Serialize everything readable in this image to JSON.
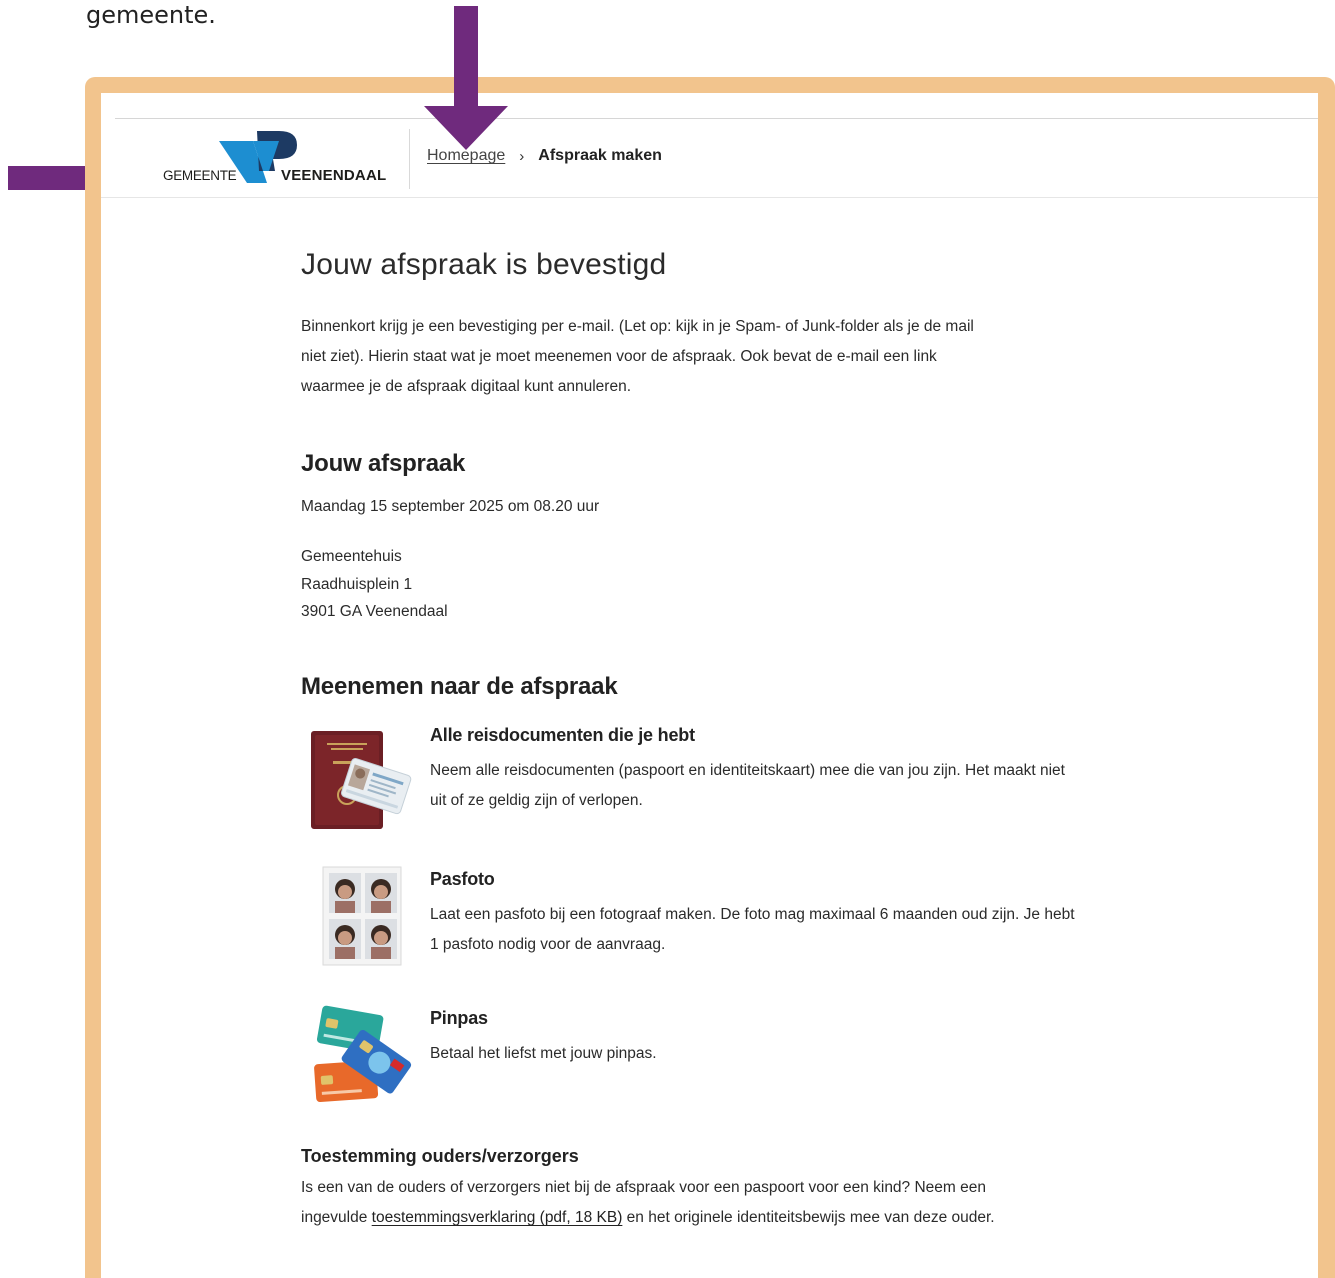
{
  "intro": {
    "text": "gemeente."
  },
  "header": {
    "logo_gemeente": "GEMEENTE",
    "logo_veenendaal": "VEENENDAAL",
    "breadcrumb": {
      "home": "Homepage",
      "separator": "›",
      "current": "Afspraak maken"
    }
  },
  "main": {
    "title": "Jouw afspraak is bevestigd",
    "confirmation": "Binnenkort krijg je een bevestiging per e-mail. (Let op: kijk in je Spam- of Junk-folder als je de mail niet ziet). Hierin staat wat je moet meenemen voor de afspraak. Ook bevat de e-mail een link waarmee je de afspraak digitaal kunt annuleren.",
    "appointment": {
      "heading": "Jouw afspraak",
      "date": "Maandag 15 september 2025 om 08.20 uur",
      "location": "Gemeentehuis",
      "street": "Raadhuisplein 1",
      "city": "3901 GA Veenendaal"
    },
    "bring": {
      "heading": "Meenemen naar de afspraak",
      "items": [
        {
          "title": "Alle reisdocumenten die je hebt",
          "desc": "Neem alle reisdocumenten (paspoort en identiteitskaart) mee die van jou zijn. Het maakt niet uit of ze geldig zijn of verlopen.",
          "icon": "passport-id-image"
        },
        {
          "title": "Pasfoto",
          "desc": "Laat een pasfoto bij een fotograaf maken. De foto mag maximaal 6 maanden oud zijn. Je hebt 1 pasfoto nodig voor de aanvraag.",
          "icon": "passport-photos-image"
        },
        {
          "title": "Pinpas",
          "desc": "Betaal het liefst met jouw pinpas.",
          "icon": "bank-cards-image"
        }
      ]
    },
    "consent": {
      "heading": "Toestemming ouders/verzorgers",
      "text_before": "Is een van de ouders of verzorgers niet bij de afspraak voor een paspoort voor een kind? Neem een ingevulde ",
      "link": "toestemmingsverklaring (pdf, 18 KB)",
      "text_after": " en het originele identiteitsbewijs mee van deze ouder."
    }
  },
  "colors": {
    "frame": "#f2c48d",
    "arrow": "#6f2a7d",
    "logo_blue": "#1d8ed1",
    "logo_dark": "#1d3a63"
  }
}
